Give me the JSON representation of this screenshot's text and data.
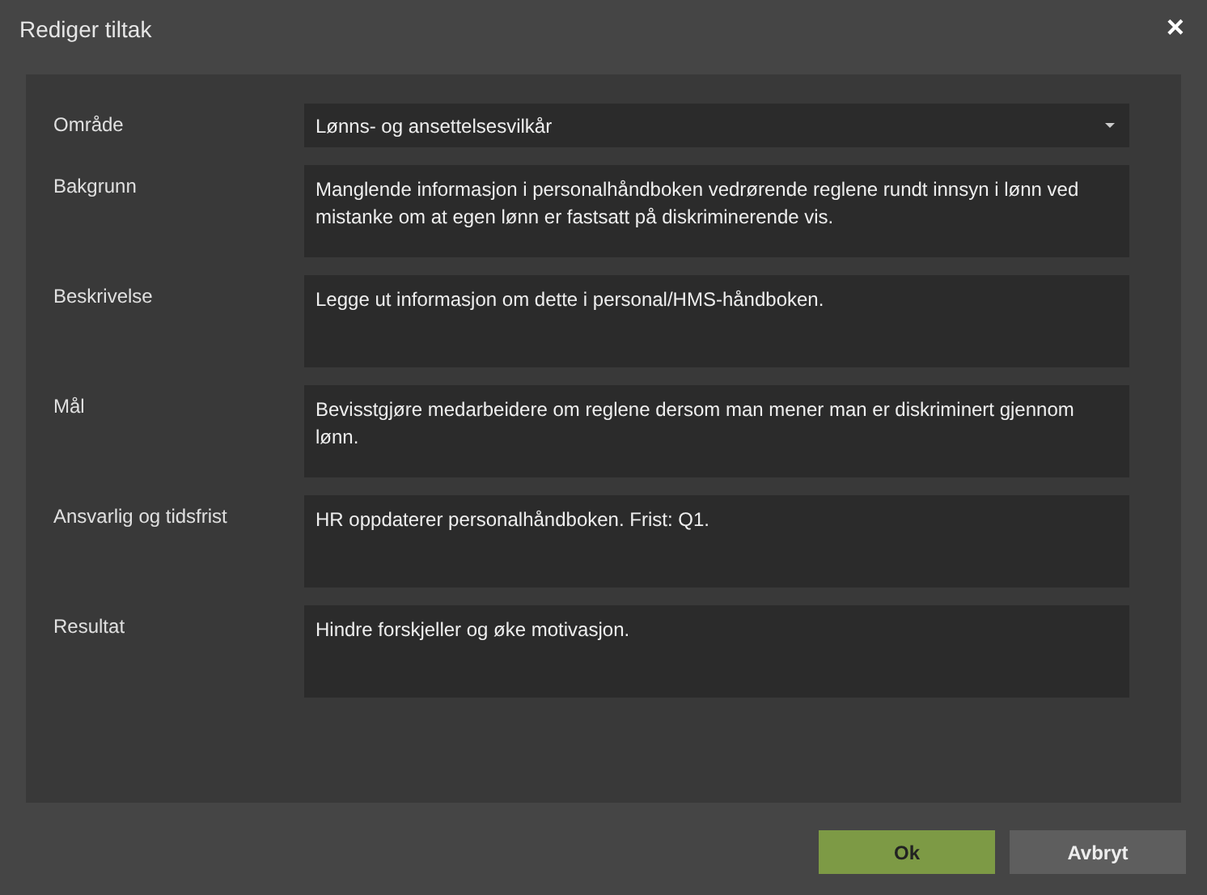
{
  "window": {
    "title": "Rediger tiltak",
    "close": "×"
  },
  "fields": [
    {
      "kind": "dropdown",
      "label": "Område",
      "value": "Lønns- og ansettelsesvilkår"
    },
    {
      "kind": "textarea",
      "label": "Bakgrunn",
      "value": "Manglende informasjon i personalhåndboken vedrørende reglene rundt innsyn i lønn ved mistanke om at egen lønn er fastsatt på diskriminerende vis."
    },
    {
      "kind": "textarea",
      "label": "Beskrivelse",
      "value": "Legge ut informasjon om dette i personal/HMS-håndboken."
    },
    {
      "kind": "textarea",
      "label": "Mål",
      "value": "Bevisstgjøre medarbeidere om reglene dersom man mener man er diskriminert gjennom lønn."
    },
    {
      "kind": "textarea",
      "label": "Ansvarlig og tidsfrist",
      "value": "HR oppdaterer personalhåndboken. Frist: Q1."
    },
    {
      "kind": "textarea",
      "label": "Resultat",
      "value": "Hindre forskjeller og øke motivasjon."
    }
  ],
  "buttons": [
    {
      "kind": "primary",
      "label": "Ok"
    },
    {
      "kind": "secondary",
      "label": "Avbryt"
    }
  ]
}
